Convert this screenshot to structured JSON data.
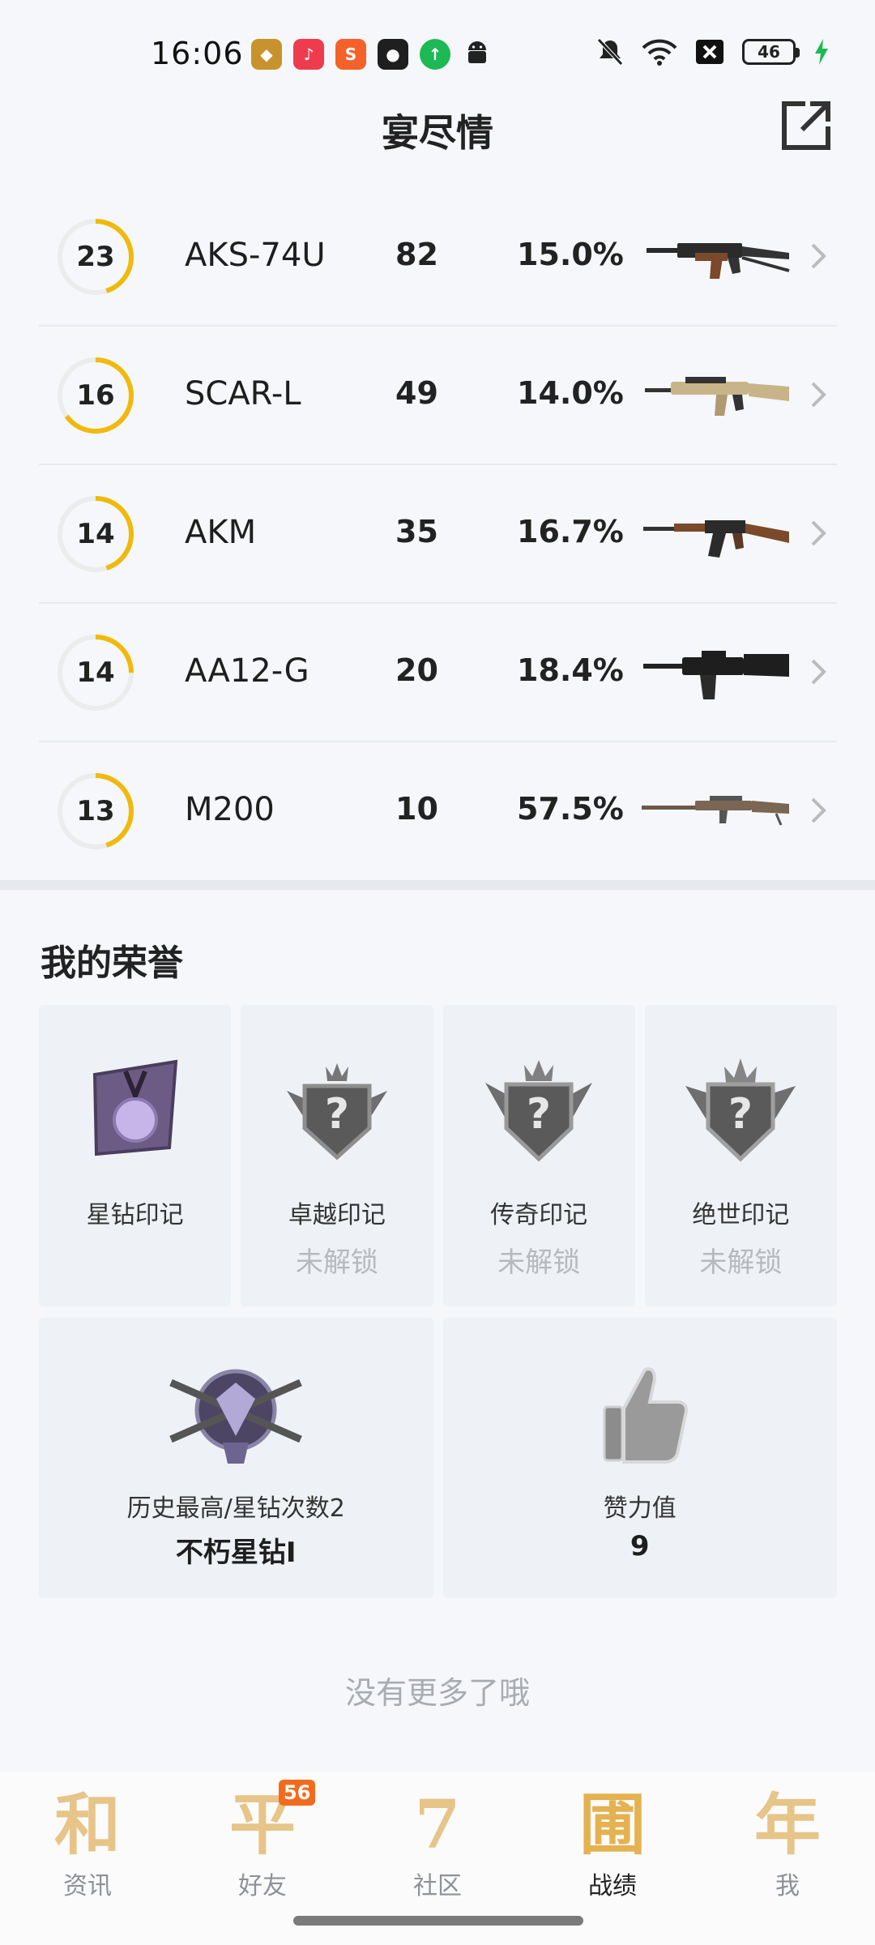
{
  "status_bar": {
    "time": "16:06",
    "battery": "46",
    "icons": [
      "game-app-icon",
      "music-app-icon",
      "sogou-app-icon",
      "shield-app-icon",
      "upload-app-icon",
      "android-icon",
      "mute-icon",
      "wifi-icon",
      "close-box-icon",
      "battery-icon",
      "charging-icon"
    ]
  },
  "header": {
    "title": "宴尽情",
    "share_icon": "share-icon"
  },
  "weapons": [
    {
      "level": "23",
      "name": "AKS-74U",
      "count": "82",
      "rate": "15.0%",
      "ring_progress": 0.45
    },
    {
      "level": "16",
      "name": "SCAR-L",
      "count": "49",
      "rate": "14.0%",
      "ring_progress": 0.65
    },
    {
      "level": "14",
      "name": "AKM",
      "count": "35",
      "rate": "16.7%",
      "ring_progress": 0.45
    },
    {
      "level": "14",
      "name": "AA12-G",
      "count": "20",
      "rate": "18.4%",
      "ring_progress": 0.25
    },
    {
      "level": "13",
      "name": "M200",
      "count": "10",
      "rate": "57.5%",
      "ring_progress": 0.45
    }
  ],
  "honors": {
    "title": "我的荣誉",
    "emblems": [
      {
        "name": "星钻印记",
        "status": ""
      },
      {
        "name": "卓越印记",
        "status": "未解锁"
      },
      {
        "name": "传奇印记",
        "status": "未解锁"
      },
      {
        "name": "绝世印记",
        "status": "未解锁"
      }
    ],
    "history": {
      "label": "历史最高/星钻次数2",
      "value": "不朽星钻I"
    },
    "likes": {
      "label": "赞力值",
      "value": "9"
    }
  },
  "no_more_text": "没有更多了哦",
  "bottom_nav": [
    {
      "glyph": "和",
      "label": "资讯",
      "badge": ""
    },
    {
      "glyph": "平",
      "label": "好友",
      "badge": "56"
    },
    {
      "glyph": "7",
      "label": "社区",
      "badge": ""
    },
    {
      "glyph": "圃",
      "label": "战绩",
      "badge": ""
    },
    {
      "glyph": "年",
      "label": "我",
      "badge": ""
    }
  ],
  "colors": {
    "accent_gold": "#f0b90b",
    "ring_track": "#ececec",
    "nav_glyph": "#e7c488"
  }
}
